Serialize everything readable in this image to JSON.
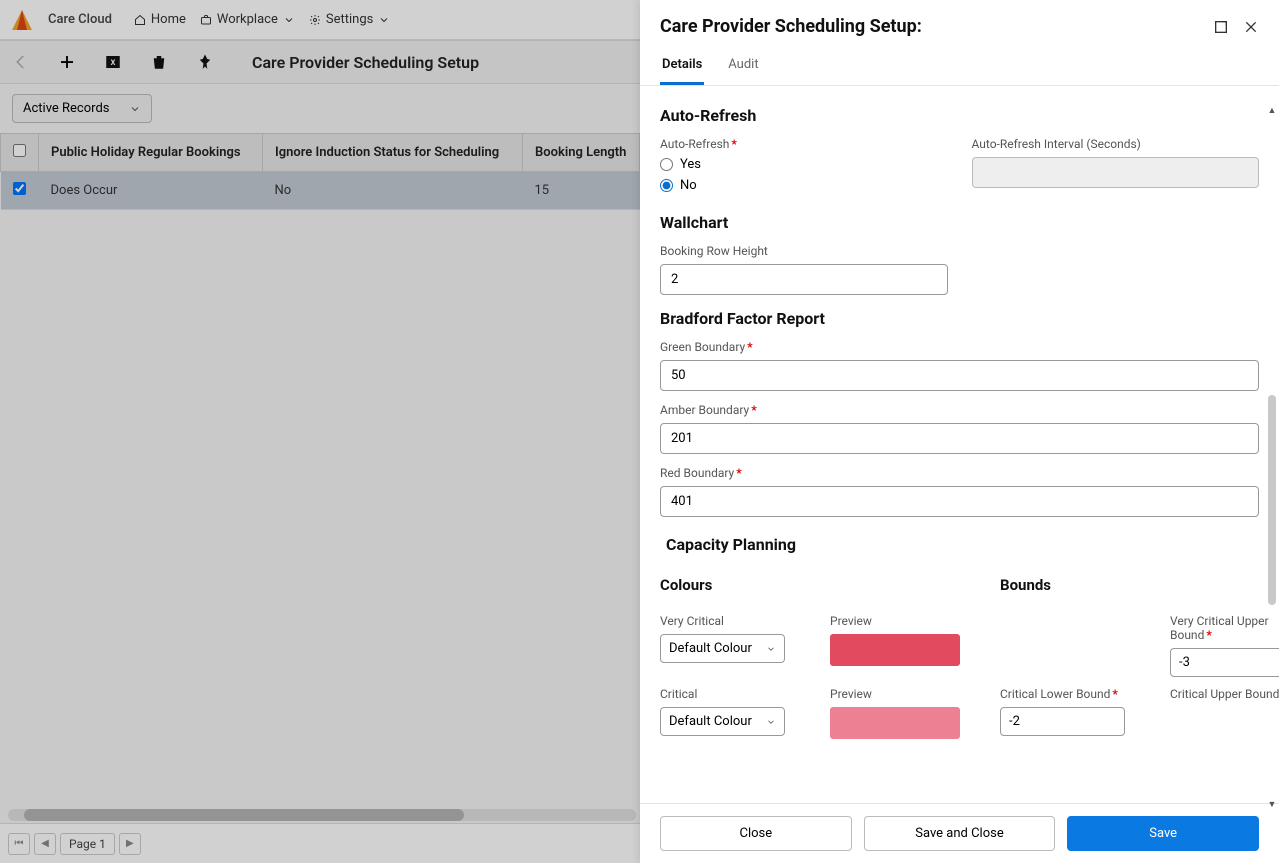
{
  "nav": {
    "brand": "Care Cloud",
    "items": [
      "Home",
      "Workplace",
      "Settings"
    ]
  },
  "page": {
    "title": "Care Provider Scheduling Setup",
    "view_selector": "Active Records",
    "pagination_label": "Page 1"
  },
  "table": {
    "headers": [
      "Public Holiday Regular Bookings",
      "Ignore Induction Status for Scheduling",
      "Booking Length"
    ],
    "rows": [
      {
        "selected": true,
        "cells": [
          "Does Occur",
          "No",
          "15"
        ]
      }
    ]
  },
  "panel": {
    "title": "Care Provider Scheduling Setup:",
    "tabs": [
      "Details",
      "Audit"
    ],
    "active_tab": 0,
    "footer": {
      "close": "Close",
      "save_close": "Save and Close",
      "save": "Save"
    },
    "sections": {
      "auto_refresh": {
        "title": "Auto-Refresh",
        "label": "Auto-Refresh",
        "yes": "Yes",
        "no": "No",
        "value": "No",
        "interval_label": "Auto-Refresh Interval (Seconds)",
        "interval_value": ""
      },
      "wallchart": {
        "title": "Wallchart",
        "row_height_label": "Booking Row Height",
        "row_height_value": "2"
      },
      "bradford": {
        "title": "Bradford Factor Report",
        "green_label": "Green Boundary",
        "green_value": "50",
        "amber_label": "Amber Boundary",
        "amber_value": "201",
        "red_label": "Red Boundary",
        "red_value": "401"
      },
      "capacity": {
        "title": "Capacity Planning",
        "colours_title": "Colours",
        "bounds_title": "Bounds",
        "very_critical_label": "Very Critical",
        "preview_label": "Preview",
        "default_colour": "Default Colour",
        "vc_upper_label": "Very Critical Upper Bound",
        "vc_upper_value": "-3",
        "critical_label": "Critical",
        "crit_lower_label": "Critical Lower Bound",
        "crit_lower_value": "-2",
        "crit_upper_label": "Critical Upper Bound",
        "vc_swatch": "#e14a5f",
        "crit_swatch": "#ed8193"
      }
    }
  }
}
